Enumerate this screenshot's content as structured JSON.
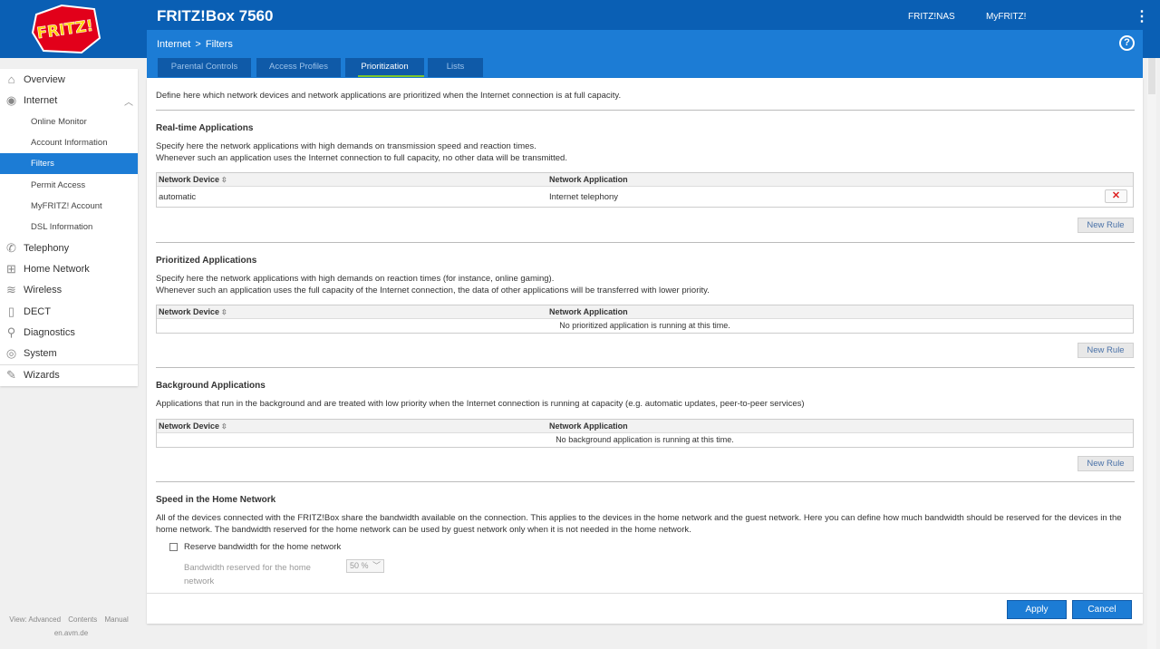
{
  "header": {
    "logo_text": "FRITZ!",
    "product": "FRITZ!Box 7560",
    "links": [
      "FRITZ!NAS",
      "MyFRITZ!"
    ],
    "menu_icon": "kebab-icon"
  },
  "subheader": {
    "breadcrumb": [
      "Internet",
      "Filters"
    ],
    "breadcrumb_sep": ">",
    "help": "?",
    "tabs": [
      {
        "label": "Parental Controls"
      },
      {
        "label": "Access Profiles"
      },
      {
        "label": "Prioritization",
        "active": true
      },
      {
        "label": "Lists"
      }
    ]
  },
  "sidebar": {
    "items": [
      {
        "label": "Overview",
        "icon": "home-icon"
      },
      {
        "label": "Internet",
        "icon": "globe-icon",
        "expanded": true
      },
      {
        "label": "Online Monitor",
        "sub": true
      },
      {
        "label": "Account Information",
        "sub": true
      },
      {
        "label": "Filters",
        "sub": true,
        "active": true
      },
      {
        "label": "Permit Access",
        "sub": true
      },
      {
        "label": "MyFRITZ! Account",
        "sub": true
      },
      {
        "label": "DSL Information",
        "sub": true
      },
      {
        "label": "Telephony",
        "icon": "phone-icon"
      },
      {
        "label": "Home Network",
        "icon": "network-icon"
      },
      {
        "label": "Wireless",
        "icon": "wifi-icon"
      },
      {
        "label": "DECT",
        "icon": "dect-icon"
      },
      {
        "label": "Diagnostics",
        "icon": "diagnostics-icon"
      },
      {
        "label": "System",
        "icon": "system-icon"
      },
      {
        "label": "Wizards",
        "icon": "wizard-icon"
      }
    ],
    "footer_links": [
      "View: Advanced",
      "Contents",
      "Manual"
    ],
    "footer_domain": "en.avm.de"
  },
  "content": {
    "intro": "Define here which network devices and network applications are prioritized when the Internet connection is at full capacity.",
    "col_device": "Network Device",
    "col_app": "Network Application",
    "new_rule": "New Rule",
    "realtime": {
      "title": "Real-time Applications",
      "desc1": "Specify here the network applications with high demands on transmission speed and reaction times.",
      "desc2": "Whenever such an application uses the Internet connection to full capacity, no other data will be transmitted.",
      "rows": [
        {
          "device": "automatic",
          "app": "Internet telephony"
        }
      ]
    },
    "prioritized": {
      "title": "Prioritized Applications",
      "desc1": "Specify here the network applications with high demands on reaction times (for instance, online gaming).",
      "desc2": "Whenever such an application uses the full capacity of the Internet connection, the data of other applications will be transferred with lower priority.",
      "empty": "No prioritized application is running at this time."
    },
    "background": {
      "title": "Background Applications",
      "desc1": "Applications that run in the background and are treated with low priority when the Internet connection is running at capacity (e.g. automatic updates, peer-to-peer services)",
      "empty": "No background application is running at this time."
    },
    "speed": {
      "title": "Speed in the Home Network",
      "desc1": "All of the devices connected with the FRITZ!Box share the bandwidth available on the connection. This applies to the devices in the home network and the guest network. Here you can define how much bandwidth should be reserved for the devices in the",
      "desc2": "home network. The bandwidth reserved for the home network can be used by guest network only when it is not needed in the home network.",
      "checkbox_label": "Reserve bandwidth for the home network",
      "checked": false,
      "bandwidth_label": "Bandwidth reserved for the home network",
      "bandwidth_value": "50 %"
    },
    "apply": "Apply",
    "cancel": "Cancel"
  },
  "colors": {
    "header_blue": "#0a5fb4",
    "subheader_blue": "#1c7cd5",
    "tab_active_underline": "#7ec52a",
    "delete_red": "#dd2222"
  }
}
